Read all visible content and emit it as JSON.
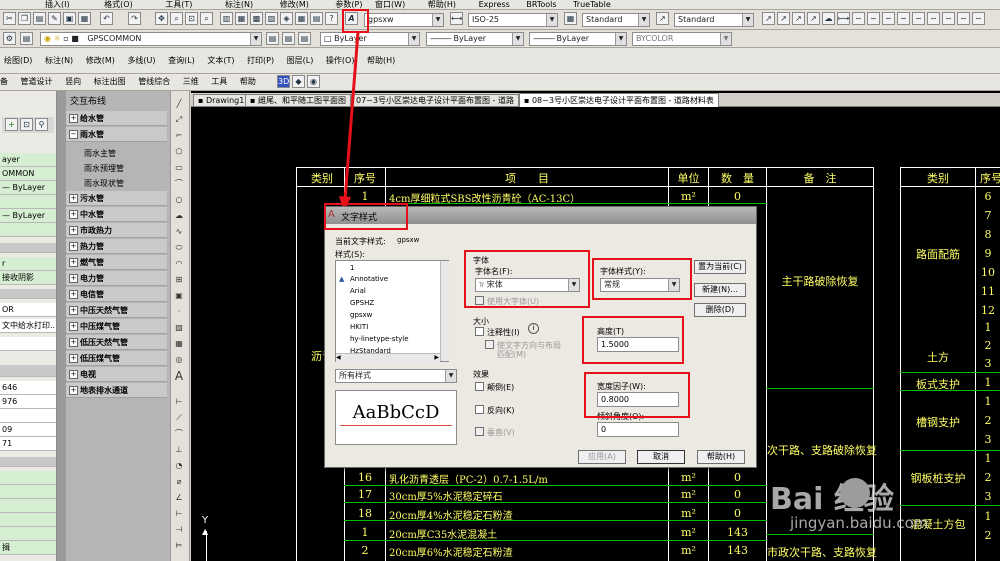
{
  "menubar": {
    "items": [
      "插入(I)",
      "格式(O)",
      "工具(T)",
      "标注(N)",
      "修改(M)",
      "参数(P)",
      "窗口(W)",
      "帮助(H)",
      "Express",
      "BRTools",
      "TrueTable"
    ]
  },
  "toolbar1": {
    "text_style": "gpsxw",
    "dim_style": "ISO-25",
    "table_style": "Standard",
    "multileader_style": "Standard"
  },
  "toolbar2": {
    "layer": "GPSCOMMON",
    "color": "ByLayer",
    "linetype": "ByLayer",
    "lineweight": "ByLayer",
    "plotstyle": "BYCOLOR"
  },
  "menubar2": {
    "items": [
      "绘图(D)",
      "标注(N)",
      "修改(M)",
      "多线(U)",
      "查询(L)",
      "文本(T)",
      "打印(P)",
      "图层(L)",
      "操作(O)",
      "帮助(H)"
    ]
  },
  "menubar3": {
    "items": [
      "备",
      "管道设计",
      "竖向",
      "标注出图",
      "管线综合",
      "三维",
      "工具",
      "帮助"
    ]
  },
  "left_props": {
    "rows": [
      "ayer",
      "OMMON",
      "— ByLayer",
      "— ByLayer",
      "r",
      "接收阴影",
      "OR",
      "文中给水打印...",
      "646",
      "976",
      "09",
      "71",
      "揖"
    ]
  },
  "tree": {
    "header": "交互布线",
    "items": [
      {
        "label": "给水管",
        "type": "cat"
      },
      {
        "label": "雨水管",
        "type": "cat-open"
      },
      {
        "label": "雨水主管",
        "type": "sub"
      },
      {
        "label": "雨水预埋管",
        "type": "sub"
      },
      {
        "label": "雨水现状管",
        "type": "sub"
      },
      {
        "label": "污水管",
        "type": "cat"
      },
      {
        "label": "中水管",
        "type": "cat"
      },
      {
        "label": "市政热力",
        "type": "cat"
      },
      {
        "label": "热力管",
        "type": "cat"
      },
      {
        "label": "燃气管",
        "type": "cat"
      },
      {
        "label": "电力管",
        "type": "cat"
      },
      {
        "label": "电信管",
        "type": "cat"
      },
      {
        "label": "中压天然气管",
        "type": "cat"
      },
      {
        "label": "中压煤气管",
        "type": "cat"
      },
      {
        "label": "低压天然气管",
        "type": "cat"
      },
      {
        "label": "低压煤气管",
        "type": "cat"
      },
      {
        "label": "电视",
        "type": "cat"
      },
      {
        "label": "地表排水通道",
        "type": "cat"
      }
    ]
  },
  "tabs": [
    "Drawing1",
    "雌尾、和平随工图平面图",
    "07~3号小区崇达电子设计平面布置图 - 道路",
    "08~3号小区崇达电子设计平面布置图 - 道路材料表"
  ],
  "table": {
    "headers": [
      "类别",
      "序号",
      "项　　目",
      "单位",
      "数　量",
      "备　注"
    ],
    "right_headers": [
      "类别",
      "序号"
    ],
    "rows": [
      {
        "seq": "1",
        "item": "4cm厚细粒式SBS改性沥青砼（AC-13C）",
        "unit": "m²",
        "qty": "0"
      },
      {
        "seq": "16",
        "item": "乳化沥青透层（PC-2）0.7-1.5L/m",
        "unit": "m²",
        "qty": "0"
      },
      {
        "seq": "17",
        "item": "30cm厚5%水泥稳定碎石",
        "unit": "m²",
        "qty": "0"
      },
      {
        "seq": "18",
        "item": "20cm厚4%水泥稳定石粉渣",
        "unit": "m²",
        "qty": "0"
      },
      {
        "seq": "1",
        "item": "20cm厚C35水泥混凝土",
        "unit": "m²",
        "qty": "143"
      },
      {
        "seq": "2",
        "item": "20cm厚6%水泥稳定石粉渣",
        "unit": "m²",
        "qty": "143"
      }
    ],
    "left_category": "沥青",
    "remarks": [
      "主干路破除恢复",
      "次干路、支路破除恢复",
      "市政次干路、支路恢复"
    ],
    "right_categories": [
      "路面配筋",
      "土方",
      "板式支护",
      "槽钢支护",
      "钢板桩支护",
      "混凝土方包"
    ],
    "right_seq": [
      "6",
      "7",
      "8",
      "9",
      "10",
      "11",
      "12",
      "1",
      "2",
      "3",
      "1",
      "1",
      "2",
      "3",
      "1",
      "2",
      "3",
      "1",
      "2"
    ]
  },
  "dialog": {
    "title": "文字样式",
    "current_style_label": "当前文字样式:",
    "current_style": "gpsxw",
    "styles_label": "样式(S):",
    "styles": [
      "1",
      "Annotative",
      "Arial",
      "GPSHZ",
      "gpsxw",
      "HKITI",
      "hy-linetype-style",
      "HzStandard"
    ],
    "filter": "所有样式",
    "preview": "AaBbCcD",
    "font_group": "字体",
    "font_name_label": "字体名(F):",
    "font_name": "宋体",
    "font_style_label": "字体样式(Y):",
    "font_style": "常规",
    "big_font_label": "使用大字体(U)",
    "size_group": "大小",
    "annotative_label": "注释性(I)",
    "match_orient_label": "使文字方向与布局",
    "match_orient_label2": "匹配(M)",
    "height_label": "高度(T)",
    "height": "1.5000",
    "effects_group": "效果",
    "upside_down": "颠倒(E)",
    "backwards": "反向(K)",
    "vertical": "垂直(V)",
    "width_factor_label": "宽度因子(W):",
    "width_factor": "0.8000",
    "oblique_label": "倾斜角度(O):",
    "oblique": "0",
    "btn_set_current": "置为当前(C)",
    "btn_new": "新建(N)...",
    "btn_delete": "删除(D)",
    "btn_apply": "应用(A)",
    "btn_cancel": "取消",
    "btn_help": "帮助(H)"
  },
  "watermark": {
    "logo": "Bai  经验",
    "url": "jingyan.baidu.com"
  },
  "colors": {
    "highlight": "#e6101a",
    "cad_text": "#ffff66",
    "cad_bg": "#000000",
    "cad_green": "#00c000"
  }
}
